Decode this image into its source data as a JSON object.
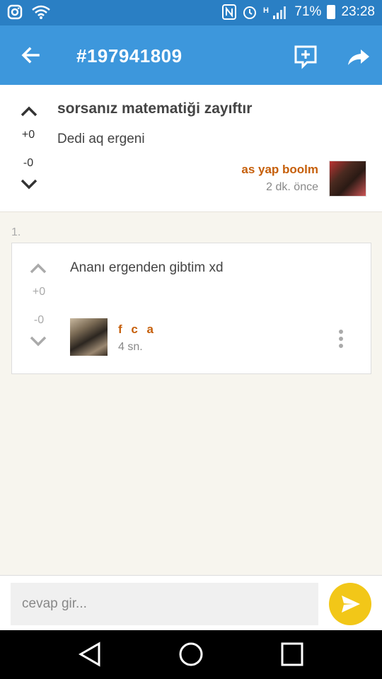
{
  "status_bar": {
    "battery": "71%",
    "time": "23:28"
  },
  "header": {
    "title": "#197941809",
    "icons": [
      "back-arrow-icon",
      "add-comment-icon",
      "share-icon"
    ]
  },
  "post": {
    "title": "sorsanız matematiği zayıftır",
    "body": "Dedi aq ergeni",
    "up_count": "+0",
    "down_count": "-0",
    "author": "as yap boolm",
    "time": "2 dk. önce"
  },
  "comments": [
    {
      "index": "1.",
      "text": "Ananı ergenden gibtim xd",
      "up_count": "+0",
      "down_count": "-0",
      "author": "f c a",
      "time": "4 sn."
    }
  ],
  "composer": {
    "placeholder": "cevap gir..."
  },
  "colors": {
    "status_bar": "#2a7fc4",
    "app_bar": "#3d97dc",
    "author": "#c65f0a",
    "send_button": "#f2c718",
    "background": "#f7f5ee"
  }
}
